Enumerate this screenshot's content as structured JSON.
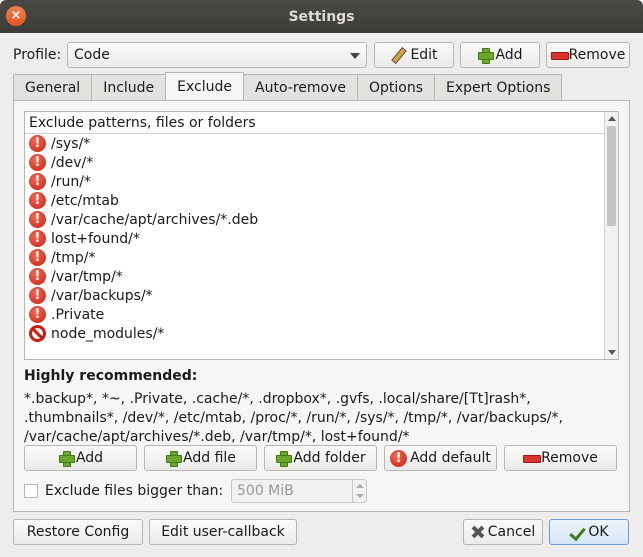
{
  "window": {
    "title": "Settings",
    "close_glyph": "×"
  },
  "profile": {
    "label": "Profile:",
    "value": "Code",
    "edit_label": "Edit",
    "add_label": "Add",
    "remove_label": "Remove"
  },
  "tabs": [
    {
      "label": "General"
    },
    {
      "label": "Include"
    },
    {
      "label": "Exclude",
      "active": true
    },
    {
      "label": "Auto-remove"
    },
    {
      "label": "Options"
    },
    {
      "label": "Expert Options"
    }
  ],
  "exclude": {
    "header": "Exclude patterns, files or folders",
    "items": [
      {
        "text": "/sys/*",
        "icon": "warning-icon"
      },
      {
        "text": "/dev/*",
        "icon": "warning-icon"
      },
      {
        "text": "/run/*",
        "icon": "warning-icon"
      },
      {
        "text": "/etc/mtab",
        "icon": "warning-icon"
      },
      {
        "text": "/var/cache/apt/archives/*.deb",
        "icon": "warning-icon"
      },
      {
        "text": "lost+found/*",
        "icon": "warning-icon"
      },
      {
        "text": "/tmp/*",
        "icon": "warning-icon"
      },
      {
        "text": "/var/tmp/*",
        "icon": "warning-icon"
      },
      {
        "text": "/var/backups/*",
        "icon": "warning-icon"
      },
      {
        "text": ".Private",
        "icon": "warning-icon"
      },
      {
        "text": "node_modules/*",
        "icon": "no-entry-icon"
      }
    ],
    "recommended_title": "Highly recommended:",
    "recommended_text": "*.backup*, *~, .Private, .cache/*, .dropbox*, .gvfs, .local/share/[Tt]rash*, .thumbnails*, /dev/*, /etc/mtab, /proc/*, /run/*, /sys/*, /tmp/*, /var/backups/*, /var/cache/apt/archives/*.deb, /var/tmp/*, lost+found/*",
    "buttons": {
      "add": "Add",
      "add_file": "Add file",
      "add_folder": "Add folder",
      "add_default": "Add default",
      "remove": "Remove"
    },
    "size_limit": {
      "label": "Exclude files bigger than:",
      "value": "500 MiB",
      "checked": false
    }
  },
  "footer": {
    "restore": "Restore Config",
    "user_callback": "Edit user-callback",
    "cancel": "Cancel",
    "ok": "OK"
  }
}
